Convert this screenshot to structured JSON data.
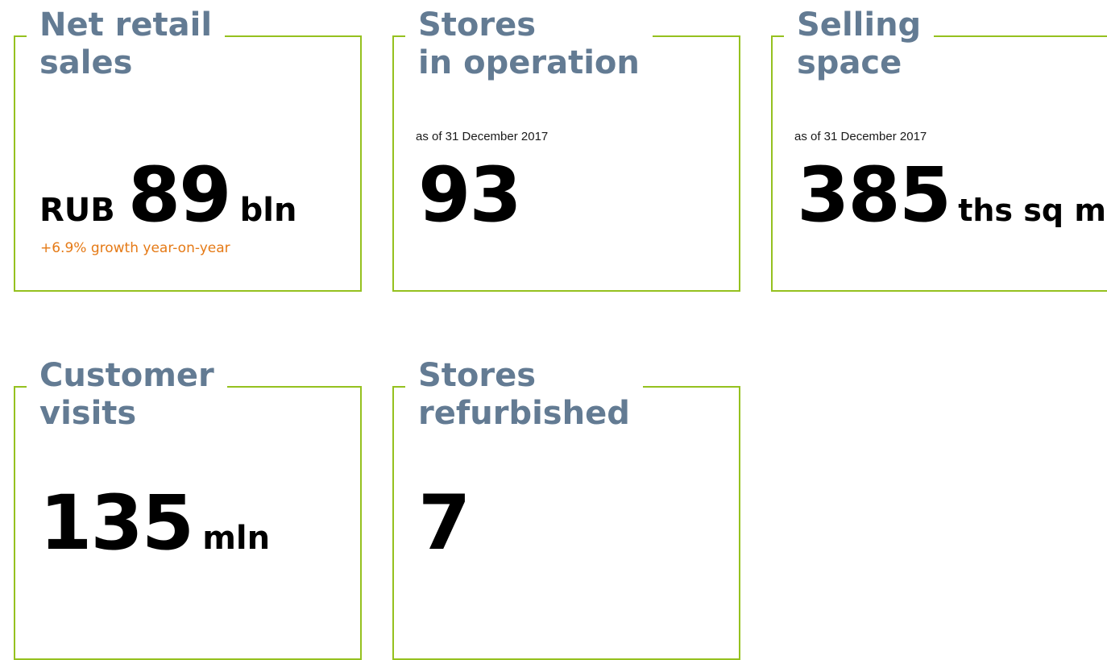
{
  "cards": [
    {
      "title_line1": "Net retail",
      "title_line2": "sales",
      "prefix": "RUB",
      "value": "89",
      "unit": "bln",
      "growth": "+6.9% growth year-on-year"
    },
    {
      "title_line1": "Stores",
      "title_line2": "in operation",
      "note": "as of 31 December 2017",
      "value": "93"
    },
    {
      "title_line1": "Selling",
      "title_line2": "space",
      "note": "as of 31 December 2017",
      "value": "385",
      "unit": "ths sq m"
    },
    {
      "title_line1": "Customer",
      "title_line2": "visits",
      "value": "135",
      "unit": "mln"
    },
    {
      "title_line1": "Stores",
      "title_line2": "refurbished",
      "value": "7"
    }
  ],
  "colors": {
    "border": "#95c11f",
    "title": "#637b93",
    "growth": "#e57a16",
    "value": "#000000"
  }
}
